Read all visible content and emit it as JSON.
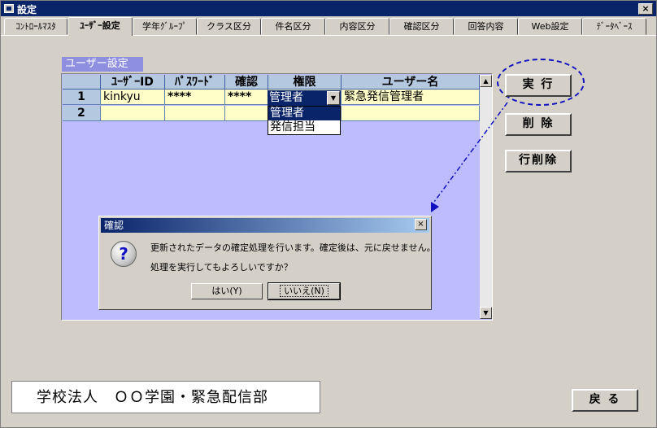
{
  "window": {
    "title": "設定",
    "close_glyph": "×"
  },
  "tabs": [
    {
      "label": "ｺﾝﾄﾛｰﾙﾏｽﾀ"
    },
    {
      "label": "ﾕｰｻﾞｰ設定"
    },
    {
      "label": "学年ｸﾞﾙｰﾌﾟ"
    },
    {
      "label": "クラス区分"
    },
    {
      "label": "件名区分"
    },
    {
      "label": "内容区分"
    },
    {
      "label": "確認区分"
    },
    {
      "label": "回答内容"
    },
    {
      "label": "Web設定"
    },
    {
      "label": "ﾃﾞｰﾀﾍﾞｰｽ"
    }
  ],
  "active_tab": "ﾕｰｻﾞｰ設定",
  "section": {
    "label": "ユーザー設定"
  },
  "grid": {
    "columns": [
      "",
      "ﾕｰｻﾞｰID",
      "ﾊﾟｽﾜｰﾄﾞ",
      "確認",
      "権限",
      "ユーザー名"
    ],
    "rows": [
      {
        "num": "1",
        "user_id": "kinkyu",
        "password": "****",
        "confirm": "****",
        "role": "管理者",
        "user_name": "緊急発信管理者"
      },
      {
        "num": "2",
        "user_id": "",
        "password": "",
        "confirm": "",
        "role": "",
        "user_name": ""
      }
    ],
    "role_dropdown": {
      "selected": "管理者",
      "options": [
        "管理者",
        "発信担当"
      ]
    }
  },
  "buttons": {
    "execute": "実 行",
    "delete": "削 除",
    "delete_row": "行削除",
    "back": "戻 る"
  },
  "org_name": "学校法人　ＯＯ学園・緊急配信部",
  "dialog": {
    "title": "確認",
    "message_line1": "更新されたデータの確定処理を行います。確定後は、元に戻せません。",
    "message_line2": "処理を実行してもよろしいですか？",
    "yes_label": "はい(Y)",
    "no_label": "いいえ(N)",
    "icon": "question-icon"
  },
  "colors": {
    "titlebar": "#0a246a",
    "grid_bg": "#bcbcff",
    "row_bg": "#fffec8",
    "annotation": "#1010c0"
  }
}
